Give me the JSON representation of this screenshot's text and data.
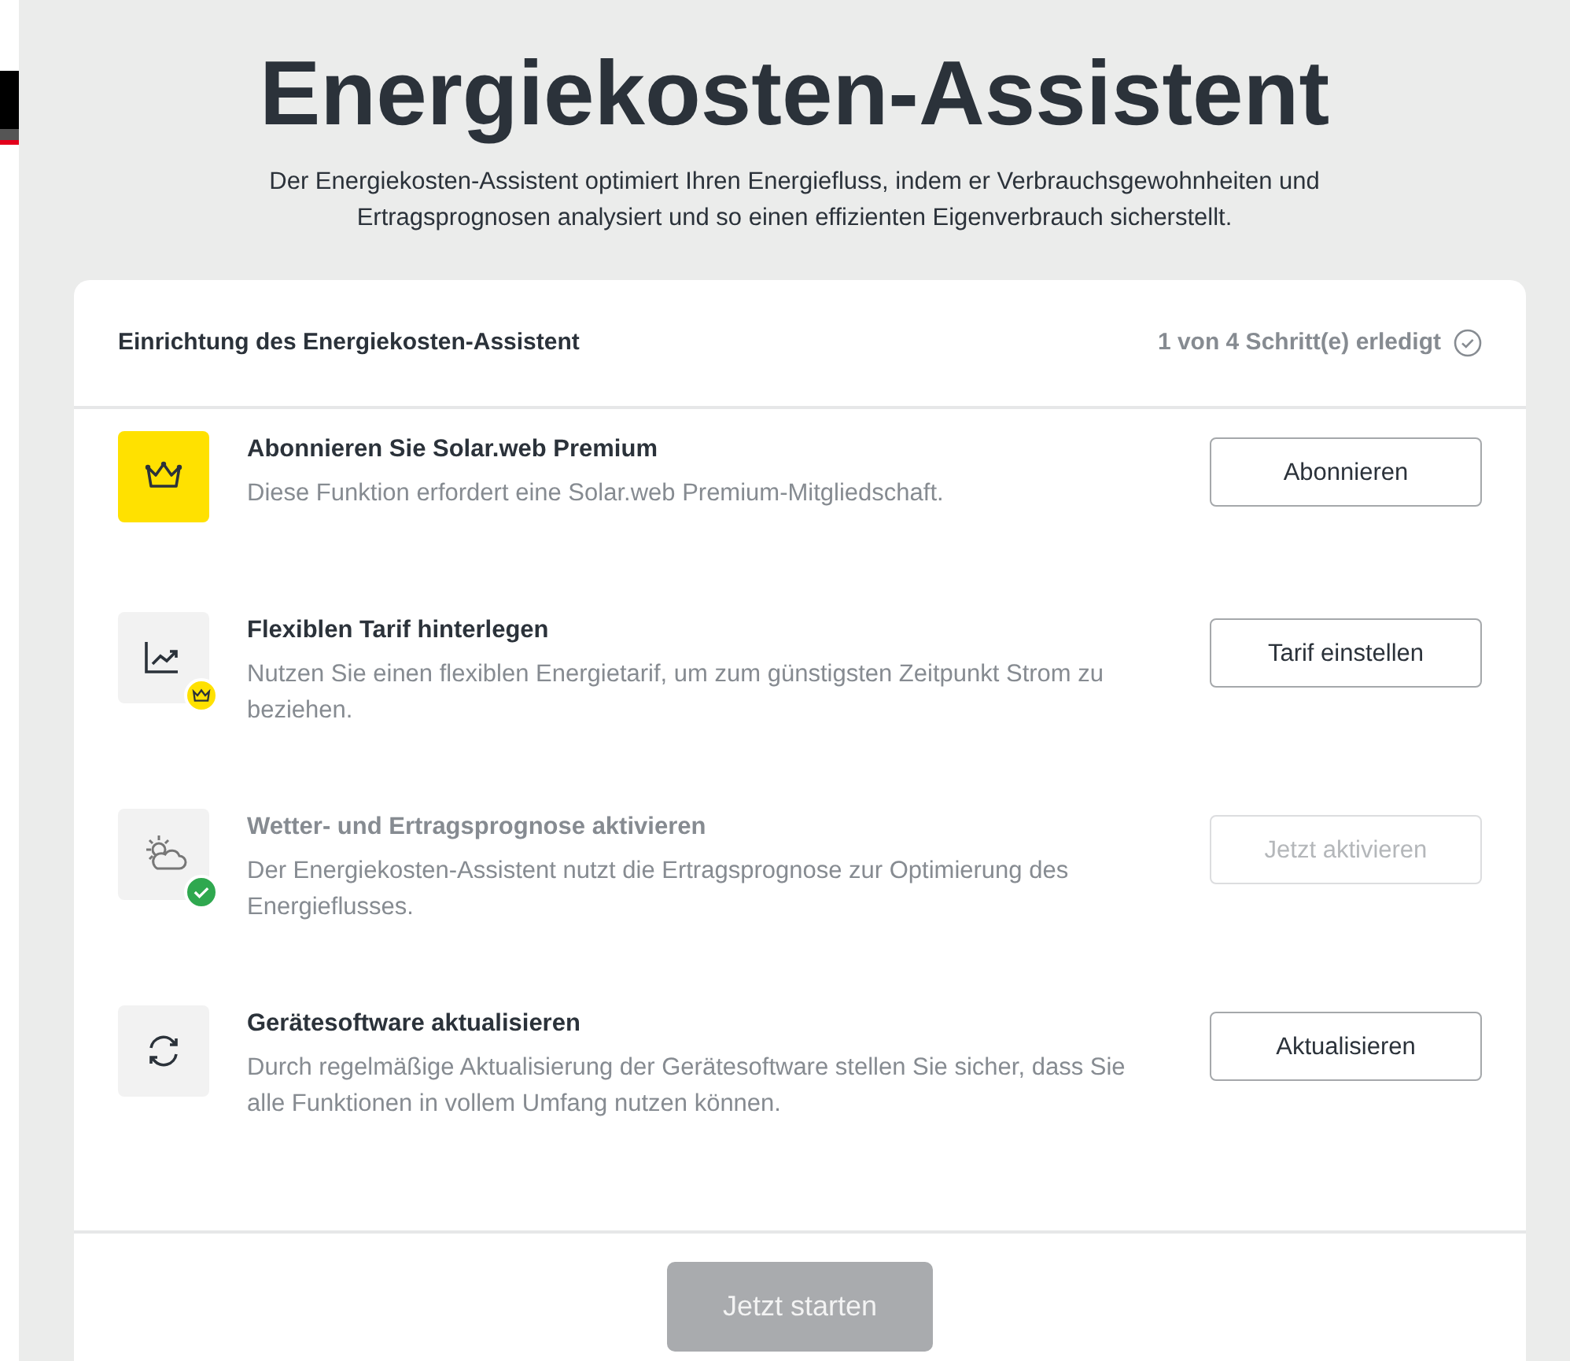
{
  "title": "Energiekosten-Assistent",
  "description": "Der Energiekosten-Assistent optimiert Ihren Energiefluss, indem er Verbrauchsgewohnheiten und Ertragsprognosen analysiert und so einen effizienten Eigenverbrauch sicherstellt.",
  "setup": {
    "heading": "Einrichtung des Energiekosten-Assistent",
    "progress": "1 von 4 Schritt(e) erledigt",
    "steps": [
      {
        "kind": "premium",
        "title": "Abonnieren Sie Solar.web Premium",
        "text": "Diese Funktion erfordert eine Solar.web Premium-Mitgliedschaft.",
        "button": "Abonnieren",
        "done": false,
        "premium_badge": false
      },
      {
        "kind": "tariff",
        "title": "Flexiblen Tarif hinterlegen",
        "text": "Nutzen Sie einen flexiblen Energietarif, um zum günstigsten Zeitpunkt Strom zu beziehen.",
        "button": "Tarif einstellen",
        "done": false,
        "premium_badge": true
      },
      {
        "kind": "forecast",
        "title": "Wetter- und Ertragsprognose aktivieren",
        "text": "Der Energiekosten-Assistent nutzt die Ertragsprognose zur Optimierung des Energieflusses.",
        "button": "Jetzt aktivieren",
        "done": true,
        "premium_badge": false
      },
      {
        "kind": "firmware",
        "title": "Gerätesoftware aktualisieren",
        "text": "Durch regelmäßige Aktualisierung der Gerätesoftware stellen Sie sicher, dass Sie alle Funktionen in vollem Umfang nutzen können.",
        "button": "Aktualisieren",
        "done": false,
        "premium_badge": false
      }
    ],
    "start_button": {
      "label": "Jetzt starten",
      "disabled": true
    }
  }
}
